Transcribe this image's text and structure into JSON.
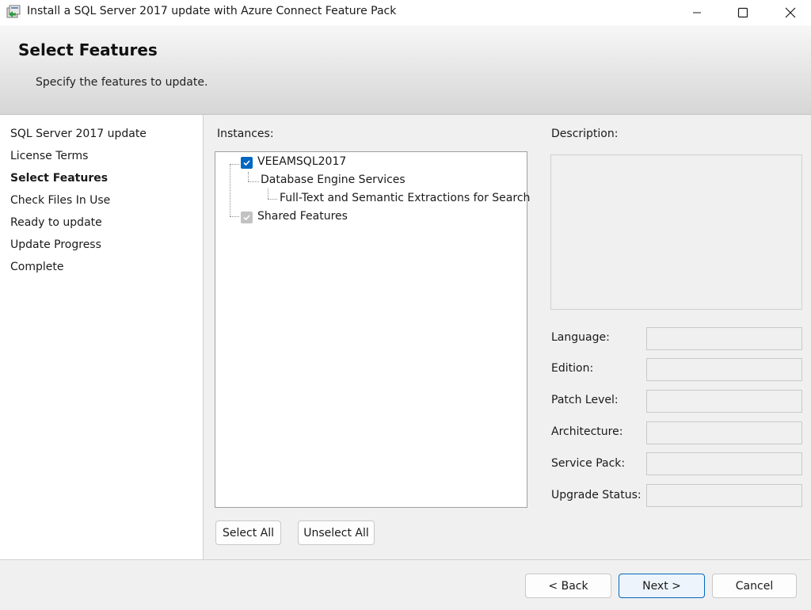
{
  "window": {
    "title": "Install a SQL Server 2017 update with Azure Connect Feature Pack",
    "controls": [
      "minimize-icon",
      "maximize-icon",
      "close-icon"
    ]
  },
  "header": {
    "title": "Select Features",
    "subtitle": "Specify the features to update."
  },
  "steps": [
    {
      "label": "SQL Server 2017 update",
      "active": false
    },
    {
      "label": "License Terms",
      "active": false
    },
    {
      "label": "Select Features",
      "active": true
    },
    {
      "label": "Check Files In Use",
      "active": false
    },
    {
      "label": "Ready to update",
      "active": false
    },
    {
      "label": "Update Progress",
      "active": false
    },
    {
      "label": "Complete",
      "active": false
    }
  ],
  "instances": {
    "label": "Instances:",
    "tree": [
      {
        "label": "VEEAMSQL2017",
        "checked": true,
        "enabled": true
      },
      {
        "label": "Database Engine Services"
      },
      {
        "label": "Full-Text and Semantic Extractions for Search"
      },
      {
        "label": "Shared Features",
        "checked": true,
        "enabled": false
      }
    ],
    "select_all": "Select All",
    "unselect_all": "Unselect All"
  },
  "details": {
    "description_label": "Description:",
    "description_text": "",
    "fields": [
      {
        "label": "Language:",
        "value": ""
      },
      {
        "label": "Edition:",
        "value": ""
      },
      {
        "label": "Patch Level:",
        "value": ""
      },
      {
        "label": "Architecture:",
        "value": ""
      },
      {
        "label": "Service Pack:",
        "value": ""
      },
      {
        "label": "Upgrade Status:",
        "value": ""
      }
    ]
  },
  "footer": {
    "back": "< Back",
    "next": "Next >",
    "cancel": "Cancel"
  },
  "colors": {
    "accent": "#0067c0",
    "disabled_check": "#c2c2c2"
  }
}
